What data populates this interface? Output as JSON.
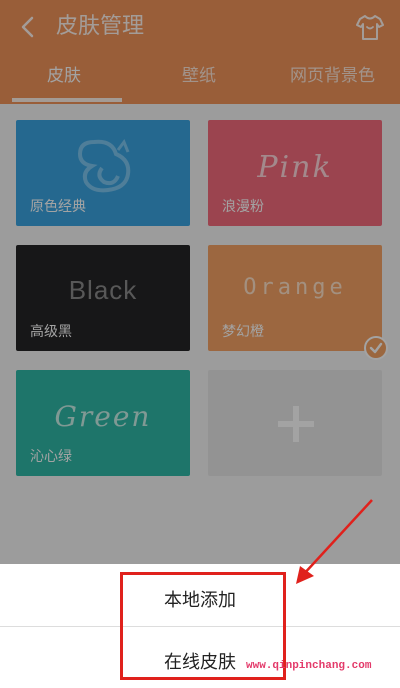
{
  "header": {
    "title": "皮肤管理"
  },
  "tabs": [
    {
      "label": "皮肤"
    },
    {
      "label": "壁纸"
    },
    {
      "label": "网页背景色"
    }
  ],
  "skins": [
    {
      "label": "原色经典"
    },
    {
      "label": "浪漫粉",
      "wordmark": "Pink"
    },
    {
      "label": "高级黑",
      "wordmark": "Black"
    },
    {
      "label": "梦幻橙",
      "wordmark": "Orange",
      "selected": true
    },
    {
      "label": "沁心绿",
      "wordmark": "Green"
    }
  ],
  "menu": {
    "items": [
      "本地添加",
      "在线皮肤"
    ]
  },
  "watermark": "www.qinpinchang.com",
  "colors": {
    "header": "#f0935a",
    "classic_blue": "#3aa3e0",
    "pink": "#f36b7c",
    "black": "#252526",
    "orange": "#f5a264",
    "green": "#2fb7a6",
    "highlight_red": "#e0211c"
  },
  "icons": {
    "back": "chevron-left-icon",
    "skin": "tshirt-icon",
    "classic_logo": "squirrel-logo-icon",
    "selected": "checkmark-icon",
    "add": "plus-icon"
  }
}
